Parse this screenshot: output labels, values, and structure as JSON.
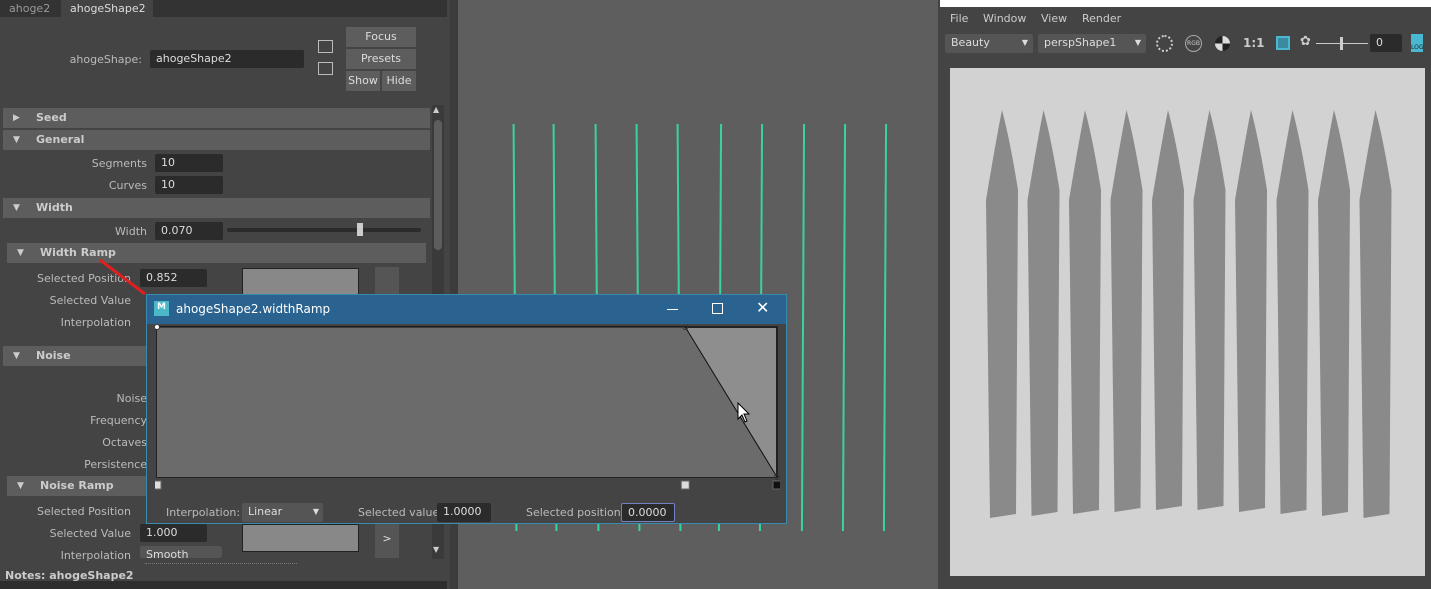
{
  "attribute_editor": {
    "tabs": [
      "ahoge2",
      "ahogeShape2"
    ],
    "node_label": "ahogeShape:",
    "node_value": "ahogeShape2",
    "buttons": {
      "focus": "Focus",
      "presets": "Presets",
      "show": "Show",
      "hide": "Hide"
    },
    "sections": {
      "seed": "Seed",
      "general": "General",
      "width": "Width",
      "width_ramp": "Width Ramp",
      "noise": "Noise",
      "noise_ramp": "Noise Ramp"
    },
    "general": {
      "segments_label": "Segments",
      "segments": "10",
      "curves_label": "Curves",
      "curves": "10"
    },
    "width": {
      "label": "Width",
      "value": "0.070",
      "slider_fraction": 0.7
    },
    "width_ramp": {
      "sel_pos_label": "Selected Position",
      "sel_pos": "0.852",
      "sel_val_label": "Selected Value",
      "interp_label": "Interpolation"
    },
    "noise": {
      "noise_label": "Noise",
      "frequency_label": "Frequency",
      "octaves_label": "Octaves",
      "persistence_label": "Persistence"
    },
    "noise_ramp": {
      "sel_pos_label": "Selected Position",
      "sel_val_label": "Selected Value",
      "sel_val": "1.000",
      "interp_label": "Interpolation",
      "interp": "Smooth",
      "arrow": ">"
    },
    "notes": "Notes:  ahogeShape2"
  },
  "ramp_dialog": {
    "title": "ahogeShape2.widthRamp",
    "interp_label": "Interpolation:",
    "interp": "Linear",
    "sel_val_label": "Selected value:",
    "sel_val": "1.0000",
    "sel_pos_label": "Selected position:",
    "sel_pos": "0.0000",
    "points": [
      [
        0,
        1
      ],
      [
        0.852,
        1
      ],
      [
        1,
        0
      ]
    ]
  },
  "render_view": {
    "menu": [
      "File",
      "Window",
      "View",
      "Render"
    ],
    "layer": "Beauty",
    "camera": "perspShape1",
    "ratio": "1:1",
    "exposure": "0",
    "rgb": "RGB",
    "log": "LOG"
  }
}
